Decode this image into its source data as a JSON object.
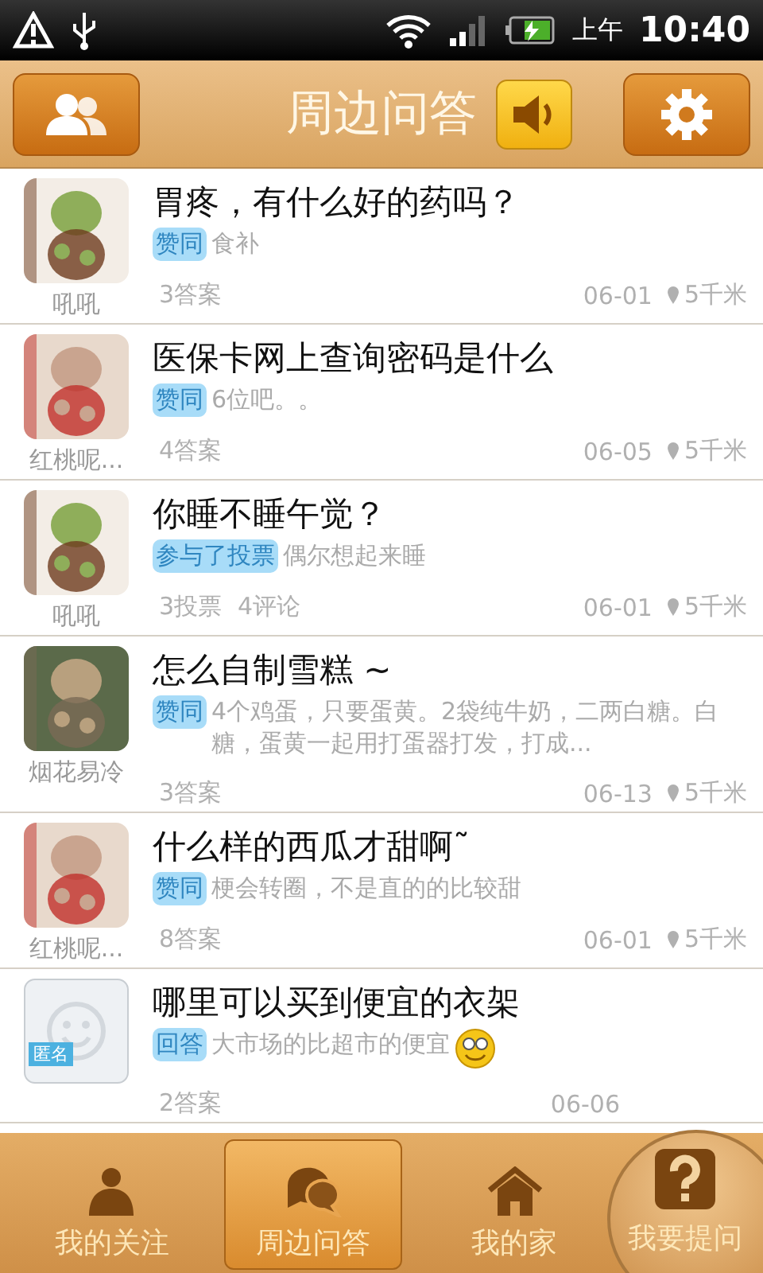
{
  "status_bar": {
    "period": "上午",
    "time": "10:40"
  },
  "header": {
    "title": "周边问答"
  },
  "questions": [
    {
      "author": "吼吼",
      "kind": "picture",
      "title": "胃疼，有什么好的药吗？",
      "tag": "赞同",
      "answer": "食补",
      "stats": [
        "3答案"
      ],
      "date": "06-01",
      "distance": "5千米"
    },
    {
      "author": "红桃呢...",
      "kind": "picture",
      "title": "医保卡网上查询密码是什么",
      "tag": "赞同",
      "answer": "6位吧。。",
      "stats": [
        "4答案"
      ],
      "date": "06-05",
      "distance": "5千米"
    },
    {
      "author": "吼吼",
      "kind": "picture",
      "title": "你睡不睡午觉？",
      "tag": "参与了投票",
      "answer": "偶尔想起来睡",
      "stats": [
        "3投票",
        "4评论"
      ],
      "date": "06-01",
      "distance": "5千米"
    },
    {
      "author": "烟花易冷",
      "kind": "picture",
      "title": "怎么自制雪糕 ~",
      "tag": "赞同",
      "answer": "4个鸡蛋，只要蛋黄。2袋纯牛奶，二两白糖。白糖，蛋黄一起用打蛋器打发，打成...",
      "stats": [
        "3答案"
      ],
      "date": "06-13",
      "distance": "5千米"
    },
    {
      "author": "红桃呢...",
      "kind": "picture",
      "title": "什么样的西瓜才甜啊˜",
      "tag": "赞同",
      "answer": "梗会转圈，不是直的的比较甜",
      "stats": [
        "8答案"
      ],
      "date": "06-01",
      "distance": "5千米"
    },
    {
      "badge": "匿名",
      "kind": "anonymous",
      "title": "哪里可以买到便宜的衣架",
      "tag": "回答",
      "answer": "大市场的比超市的便宜",
      "emoji": true,
      "stats": [
        "2答案"
      ],
      "date": "06-06"
    }
  ],
  "tabs": [
    {
      "label": "我的关注",
      "kind": "person",
      "selected": false
    },
    {
      "label": "周边问答",
      "kind": "chat",
      "selected": true
    },
    {
      "label": "我的家",
      "kind": "home",
      "selected": false
    }
  ],
  "ask_button": {
    "label": "我要提问"
  }
}
